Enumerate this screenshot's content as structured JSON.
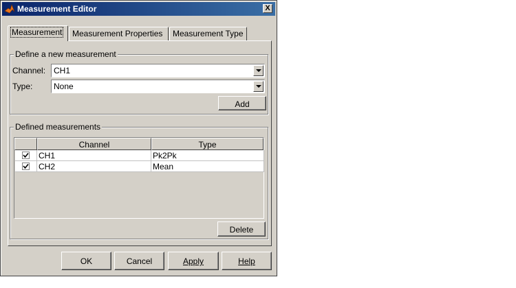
{
  "window": {
    "title": "Measurement Editor",
    "close_label": "X"
  },
  "tabs": [
    {
      "label": "Measurement",
      "active": true
    },
    {
      "label": "Measurement Properties",
      "active": false
    },
    {
      "label": "Measurement Type",
      "active": false
    }
  ],
  "define_group": {
    "title": "Define a new measurement",
    "channel_label": "Channel:",
    "channel_value": "CH1",
    "type_label": "Type:",
    "type_value": "None",
    "add_button": "Add"
  },
  "defined_group": {
    "title": "Defined measurements",
    "columns": [
      "",
      "Channel",
      "Type"
    ],
    "rows": [
      {
        "checked": true,
        "channel": "CH1",
        "type": "Pk2Pk"
      },
      {
        "checked": true,
        "channel": "CH2",
        "type": "Mean"
      }
    ],
    "delete_button": "Delete"
  },
  "footer": {
    "ok": "OK",
    "cancel": "Cancel",
    "apply": "Apply",
    "help": "Help"
  }
}
